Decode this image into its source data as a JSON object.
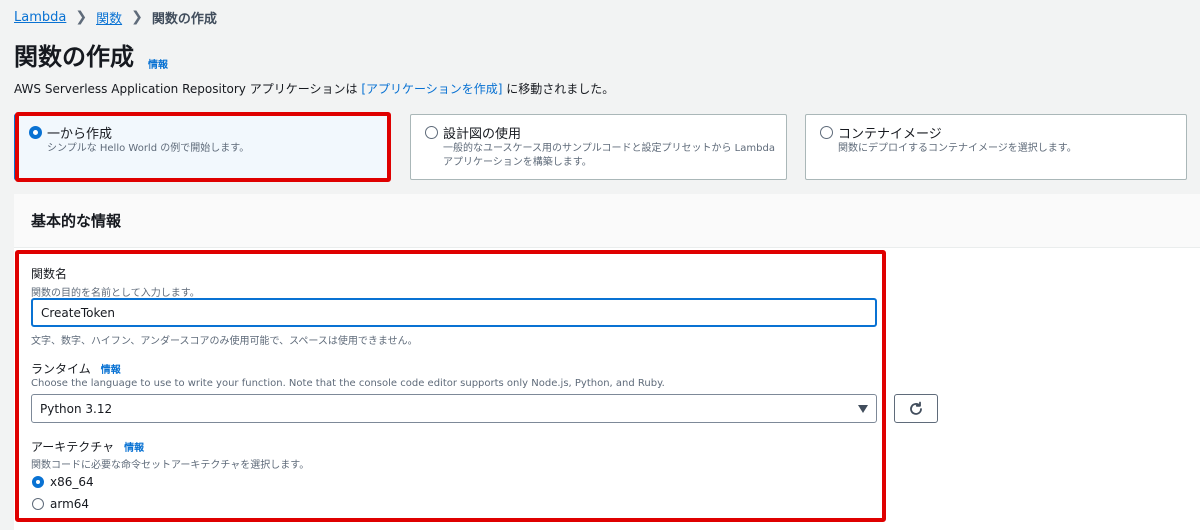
{
  "breadcrumb": {
    "root": "Lambda",
    "parent": "関数",
    "current": "関数の作成"
  },
  "page": {
    "title": "関数の作成",
    "info_link": "情報",
    "notice_prefix": "AWS Serverless Application Repository アプリケーションは ",
    "notice_link": "[アプリケーションを作成]",
    "notice_suffix": " に移動されました。"
  },
  "options": [
    {
      "title": "一から作成",
      "desc": "シンプルな Hello World の例で開始します。",
      "selected": true
    },
    {
      "title": "設計図の使用",
      "desc_line1": "一般的なユースケース用のサンプルコードと設定プリセットから Lambda",
      "desc_line2": "アプリケーションを構築します。",
      "selected": false
    },
    {
      "title": "コンテナイメージ",
      "desc": "関数にデプロイするコンテナイメージを選択します。",
      "selected": false
    }
  ],
  "basic": {
    "title": "基本的な情報",
    "function_name": {
      "label": "関数名",
      "desc": "関数の目的を名前として入力します。",
      "value": "CreateToken",
      "hint": "文字、数字、ハイフン、アンダースコアのみ使用可能で、スペースは使用できません。"
    },
    "runtime": {
      "label": "ランタイム",
      "info": "情報",
      "desc": "Choose the language to use to write your function. Note that the console code editor supports only Node.js, Python, and Ruby.",
      "value": "Python 3.12"
    },
    "architecture": {
      "label": "アーキテクチャ",
      "info": "情報",
      "desc": "関数コードに必要な命令セットアーキテクチャを選択します。",
      "options": [
        "x86_64",
        "arm64"
      ],
      "selected": "x86_64"
    }
  },
  "colors": {
    "accent": "#0972d3",
    "highlight": "#df0000"
  }
}
